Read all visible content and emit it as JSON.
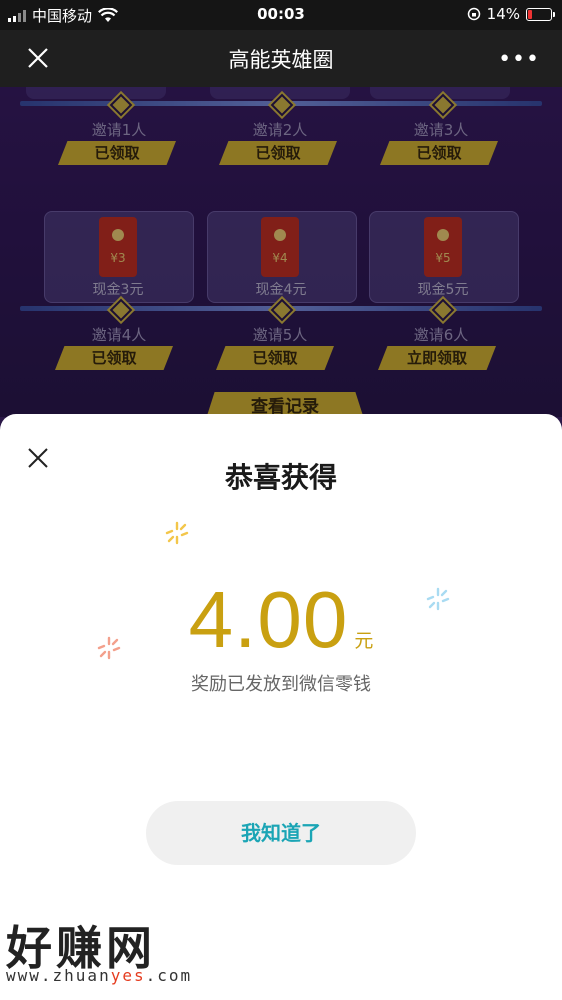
{
  "status_bar": {
    "carrier": "中国移动",
    "time": "00:03",
    "battery": "14%"
  },
  "nav": {
    "title": "高能英雄圈"
  },
  "background": {
    "rewards_row1": [
      {
        "invite": "邀请1人",
        "status": "已领取"
      },
      {
        "invite": "邀请2人",
        "status": "已领取"
      },
      {
        "invite": "邀请3人",
        "status": "已领取"
      }
    ],
    "rewards_row2": [
      {
        "amount": "¥3",
        "cash": "现金3元",
        "invite": "邀请4人",
        "status": "已领取"
      },
      {
        "amount": "¥4",
        "cash": "现金4元",
        "invite": "邀请5人",
        "status": "已领取"
      },
      {
        "amount": "¥5",
        "cash": "现金5元",
        "invite": "邀请6人",
        "status": "立即领取"
      }
    ],
    "record_button": "查看记录"
  },
  "sheet": {
    "title": "恭喜获得",
    "amount": "4.00",
    "unit": "元",
    "subtext": "奖励已发放到微信零钱",
    "confirm_button": "我知道了"
  },
  "watermark": {
    "brand": "好赚网",
    "url_prefix": "www.zhuan",
    "url_highlight": "yes",
    "url_suffix": ".com"
  },
  "colors": {
    "gold": "#c9a011",
    "teal": "#1ba5b5",
    "purple_bg": "#2a1747"
  }
}
